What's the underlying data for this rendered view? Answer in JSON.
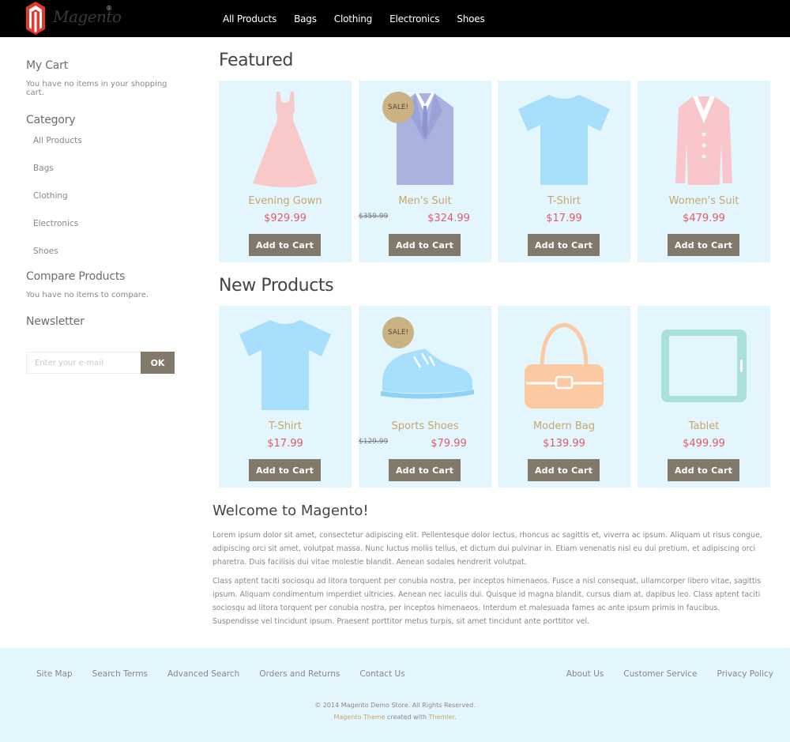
{
  "header": {
    "logo_text": "Magento",
    "logo_reg": "®",
    "nav": [
      "All Products",
      "Bags",
      "Clothing",
      "Electronics",
      "Shoes"
    ]
  },
  "sidebar": {
    "cart_title": "My Cart",
    "cart_text": "You have no items in your shopping cart.",
    "category_title": "Category",
    "categories": [
      "All Products",
      "Bags",
      "Clothing",
      "Electronics",
      "Shoes"
    ],
    "compare_title": "Compare Products",
    "compare_text": "You have no items to compare.",
    "newsletter_title": "Newsletter",
    "newsletter_placeholder": "Enter your e-mail",
    "newsletter_button": "OK"
  },
  "featured": {
    "title": "Featured",
    "products": [
      {
        "name": "Evening Gown",
        "price": "$929.99",
        "old_price": "",
        "sale": "",
        "icon": "dress-icon",
        "color": "#f9c9c9"
      },
      {
        "name": "Men's Suit",
        "price": "$324.99",
        "old_price": "$359.99",
        "sale": "SALE!",
        "icon": "suit-icon",
        "color": "#aab2df"
      },
      {
        "name": "T-Shirt",
        "price": "$17.99",
        "old_price": "",
        "sale": "",
        "icon": "tshirt-icon",
        "color": "#a7defc"
      },
      {
        "name": "Women's Suit",
        "price": "$479.99",
        "old_price": "",
        "sale": "",
        "icon": "blazer-icon",
        "color": "#f9c6cb"
      }
    ]
  },
  "new_products": {
    "title": "New Products",
    "products": [
      {
        "name": "T-Shirt",
        "price": "$17.99",
        "old_price": "",
        "sale": "",
        "icon": "tshirt-icon",
        "color": "#a7defc"
      },
      {
        "name": "Sports Shoes",
        "price": "$79.99",
        "old_price": "$129.99",
        "sale": "SALE!",
        "icon": "sneaker-icon",
        "color": "#a7defc"
      },
      {
        "name": "Modern Bag",
        "price": "$139.99",
        "old_price": "",
        "sale": "",
        "icon": "bag-icon",
        "color": "#fbc9a2"
      },
      {
        "name": "Tablet",
        "price": "$499.99",
        "old_price": "",
        "sale": "",
        "icon": "tablet-icon",
        "color": "#a9e0dc"
      }
    ]
  },
  "add_to_cart_label": "Add to Cart",
  "welcome": {
    "title": "Welcome to Magento!",
    "p1": "Lorem ipsum dolor sit amet, consectetur adipiscing elit. Pellentesque dolor lectus, rhoncus ac sagittis et, viverra ac ipsum. Aliquam ut risus congue, adipiscing orci sit amet, volutpat massa. Nunc luctus mollis tellus, et dictum dui pulvinar in. Etiam venenatis nisl eu dui pretium, et adipiscing orci pharetra. Duis facilisis dui vitae molestie blandit. Aenean sodales hendrerit volutpat.",
    "p2": "Class aptent taciti sociosqu ad litora torquent per conubia nostra, per inceptos himenaeos. Fusce a nisl consequat, ullamcorper libero vitae, sagittis ipsum. Aliquam condimentum imperdiet ultricies. Aenean nec iaculis dui. Quisque id magna blandit, cursus diam at, dapibus leo. Class aptent taciti sociosqu ad litora torquent per conubia nostra, per inceptos himenaeos. Interdum et malesuada fames ac ante ipsum primis in faucibus. Suspendisse vel tincidunt ipsum. Praesent porttitor metus turpis, sit amet tincidunt ante porttitor vel."
  },
  "footer": {
    "links_left": [
      "Site Map",
      "Search Terms",
      "Advanced Search",
      "Orders and Returns",
      "Contact Us"
    ],
    "links_right": [
      "About Us",
      "Customer Service",
      "Privacy Policy"
    ],
    "copyright": "© 2014 Magento Demo Store. All Rights Reserved.",
    "credit_theme": "Magento Theme",
    "credit_mid": " created with ",
    "credit_by": "Themler",
    "credit_end": "."
  },
  "colors": {
    "header_bg": "#000000",
    "card_bg": "#e4f6fd",
    "button_bg": "#82796b",
    "product_name": "#c9a56a",
    "price": "#e05a68",
    "sale_badge": "#c9b384",
    "logo_red": "#e4372e"
  }
}
